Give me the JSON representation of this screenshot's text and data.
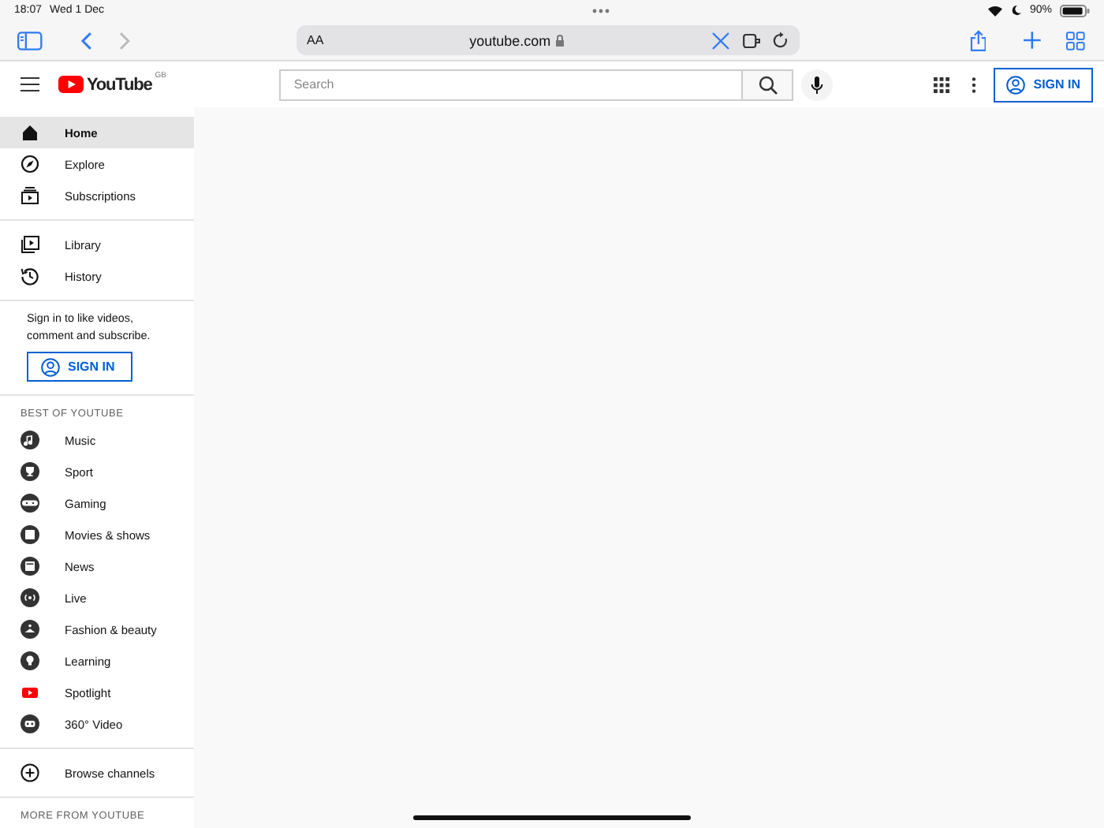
{
  "status_bar": {
    "time": "18:07",
    "date": "Wed 1 Dec",
    "battery": "90%"
  },
  "browser": {
    "text_size": "AA",
    "url": "youtube.com"
  },
  "header": {
    "logo": "YouTube",
    "region": "GB",
    "search": {
      "placeholder": "Search"
    },
    "sign_in": "SIGN IN"
  },
  "sidebar": {
    "main": [
      {
        "label": "Home",
        "selected": true
      },
      {
        "label": "Explore",
        "selected": false
      },
      {
        "label": "Subscriptions",
        "selected": false
      }
    ],
    "library": [
      {
        "label": "Library",
        "selected": false
      },
      {
        "label": "History",
        "selected": false
      }
    ],
    "sign_in_prompt": "Sign in to like videos, comment and subscribe.",
    "sign_in": "SIGN IN",
    "best_heading": "BEST OF YOUTUBE",
    "best": [
      {
        "label": "Music",
        "selected": false
      },
      {
        "label": "Sport",
        "selected": false
      },
      {
        "label": "Gaming",
        "selected": false
      },
      {
        "label": "Movies & shows",
        "selected": false
      },
      {
        "label": "News",
        "selected": false
      },
      {
        "label": "Live",
        "selected": false
      },
      {
        "label": "Fashion & beauty",
        "selected": false
      },
      {
        "label": "Learning",
        "selected": false
      },
      {
        "label": "Spotlight",
        "selected": false
      },
      {
        "label": "360° Video",
        "selected": false
      }
    ],
    "browse": {
      "label": "Browse channels",
      "selected": false
    },
    "more_heading": "MORE FROM YOUTUBE"
  }
}
